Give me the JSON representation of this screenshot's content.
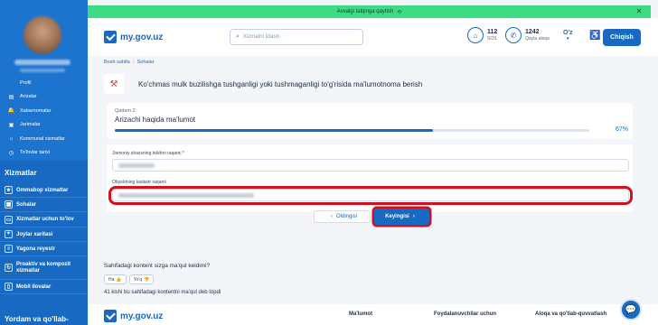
{
  "banner": {
    "text": "Avvalgi talqinga qaytish",
    "icon": "refresh-icon"
  },
  "sidebar": {
    "menu": [
      {
        "label": "Profil",
        "icon": "user-icon"
      },
      {
        "label": "Arizalar",
        "icon": "document-icon"
      },
      {
        "label": "Xabarnomalar",
        "icon": "bell-icon"
      },
      {
        "label": "Jarimalar",
        "icon": "fine-icon"
      },
      {
        "label": "Kommunal xizmatlar",
        "icon": "utility-icon"
      },
      {
        "label": "To'lovlar tarixi",
        "icon": "history-icon"
      }
    ],
    "services_title": "Xizmatlar",
    "services": [
      {
        "label": "Ommabop xizmatlar"
      },
      {
        "label": "Sohalar"
      },
      {
        "label": "Xizmatlar uchun to'lov"
      },
      {
        "label": "Joylar xaritasi"
      },
      {
        "label": "Yagona reyestr"
      },
      {
        "label": "Proaktiv va kompozit xizmatlar"
      },
      {
        "label": "Mobil ilovalar"
      }
    ],
    "help_title": "Yordam va qo'llab-"
  },
  "header": {
    "logo": "my.gov.uz",
    "search_placeholder": "Xizmatni izlash",
    "sos_count": "112",
    "sos_label": "SOS",
    "callback_count": "1242",
    "callback_label": "Qayta aloqa",
    "lang": "O'z",
    "login": "Chiqish"
  },
  "breadcrumb": {
    "home": "Bosh sahifa",
    "current": "Sohalar"
  },
  "page": {
    "title": "Ko'chmas mulk buzilishga tushganligi yoki tushmaganligi to'g'risida ma'lumotnoma berish"
  },
  "step": {
    "number": "Qadam 2:",
    "name": "Arizachi haqida ma'lumot",
    "progress_percent": 67,
    "progress_label": "67%"
  },
  "form": {
    "phone_label": "Jismoniy shaxsning telefon raqami *",
    "cadastre_label": "Obyektning kadastr raqami"
  },
  "buttons": {
    "prev": "Oldingisi",
    "next": "Keyingisi"
  },
  "feedback": {
    "question": "Sahifadagi kontent sizga ma'qul keldimi?",
    "yes": "Ha",
    "no": "Yo'q",
    "count_text": "41 kishi bu sahifadagi kontentni ma'qul deb topdi"
  },
  "footer": {
    "logo": "my.gov.uz",
    "col1": "Ma'lumot",
    "col2": "Foydalanuvchilar uchun",
    "col3": "Aloqa va qo'llab-quvvatlash"
  },
  "colors": {
    "primary": "#1769c2",
    "banner": "#3ddc84",
    "highlight": "#d0121f"
  }
}
